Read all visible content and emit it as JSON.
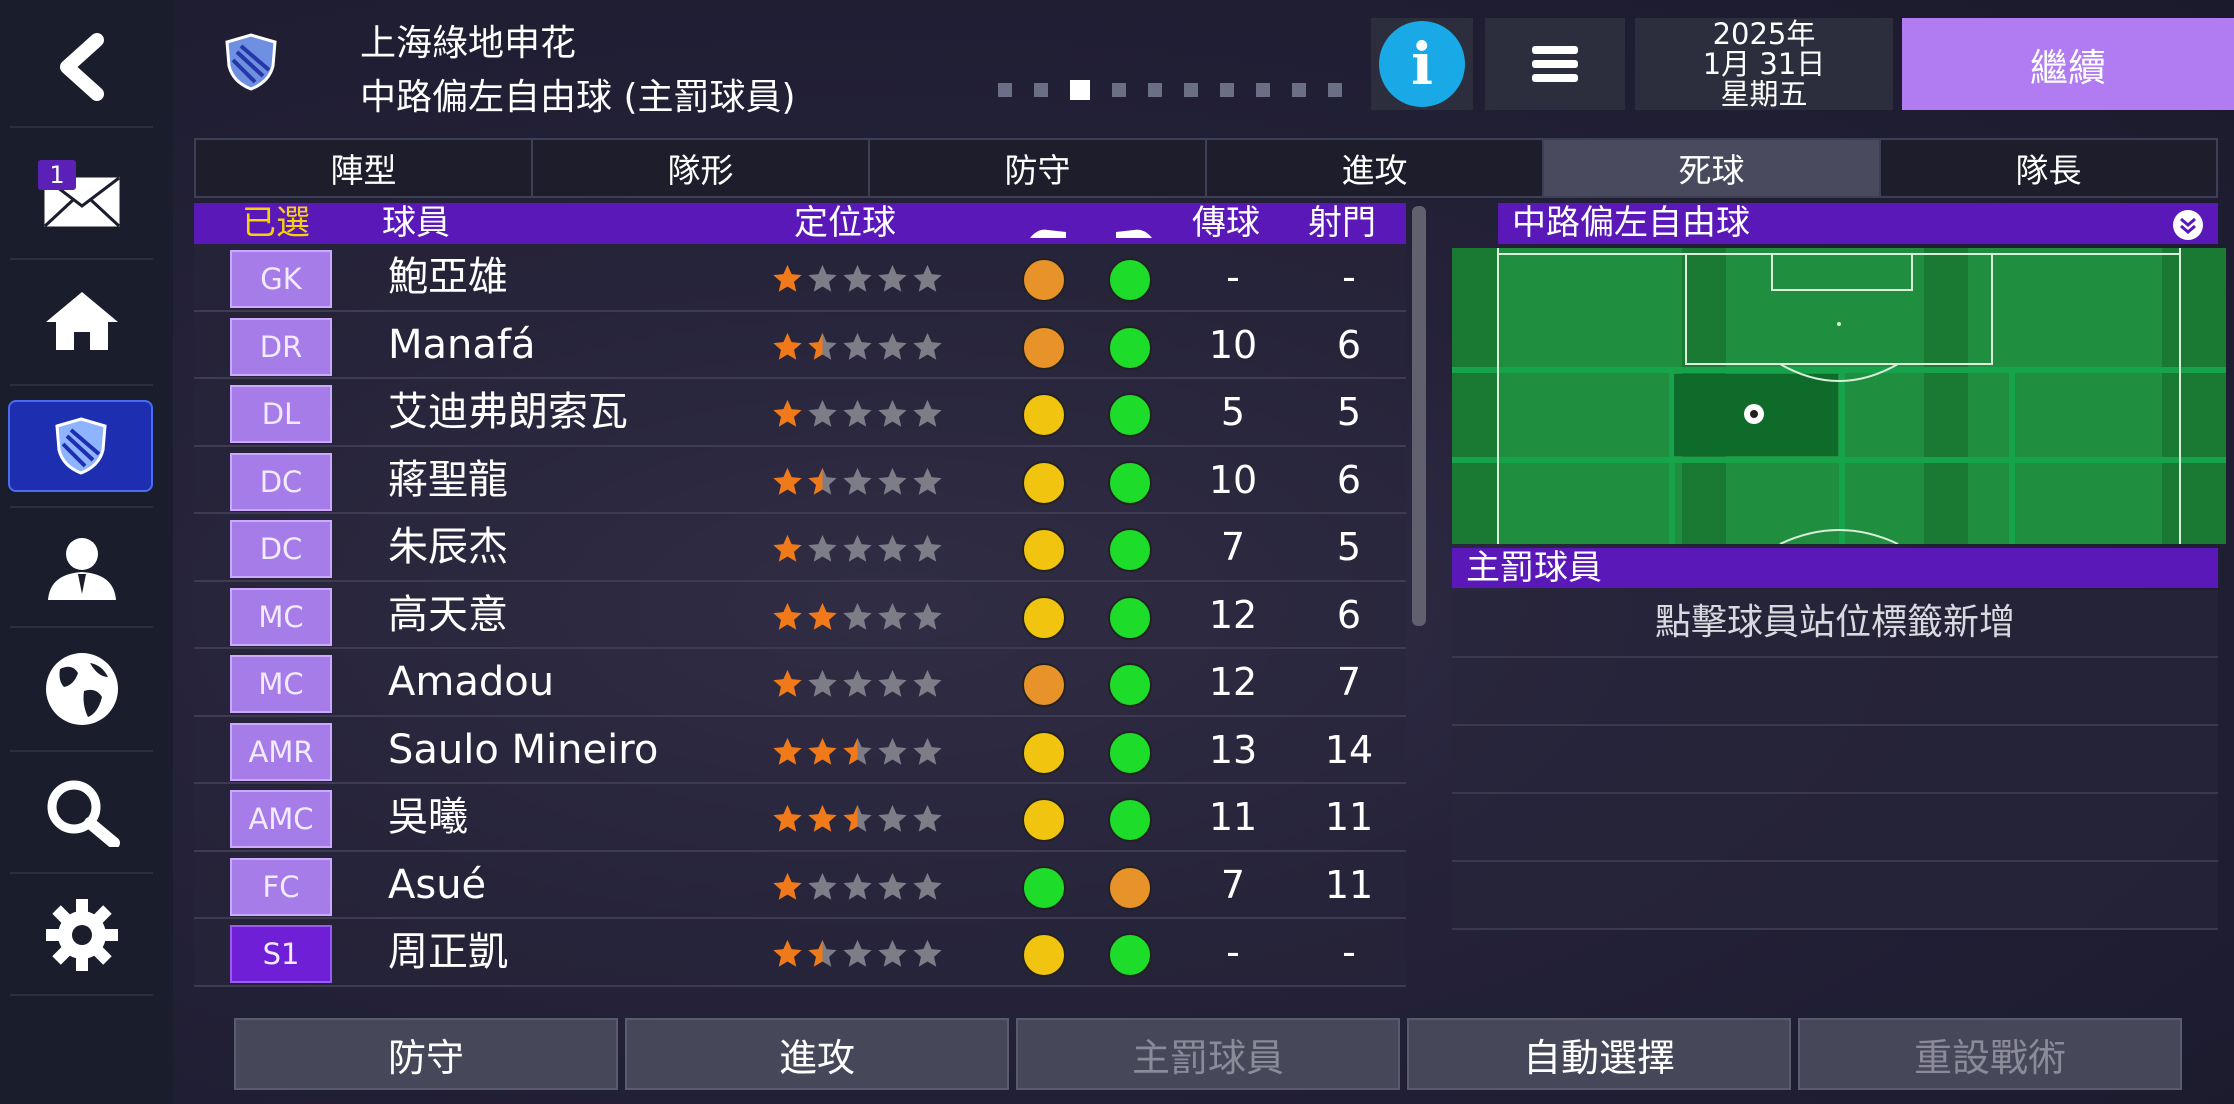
{
  "sidebar": {
    "mail_count": "1",
    "items": [
      {
        "name": "back-icon"
      },
      {
        "name": "inbox-icon"
      },
      {
        "name": "home-icon"
      },
      {
        "name": "club-shield-icon"
      },
      {
        "name": "manager-icon"
      },
      {
        "name": "world-icon"
      },
      {
        "name": "search-icon"
      },
      {
        "name": "settings-icon"
      }
    ]
  },
  "header": {
    "club_name": "上海綠地申花",
    "subtitle": "中路偏左自由球 (主罰球員)",
    "date_year": "2025年",
    "date_day": "1月 31日",
    "date_weekday": "星期五",
    "continue_label": "繼續",
    "page_dots": 10,
    "active_dot": 2
  },
  "tabs": [
    {
      "label": "陣型"
    },
    {
      "label": "隊形"
    },
    {
      "label": "防守"
    },
    {
      "label": "進攻"
    },
    {
      "label": "死球",
      "active": true
    },
    {
      "label": "隊長"
    }
  ],
  "table": {
    "headers": {
      "selected": "已選",
      "player": "球員",
      "set_piece": "定位球",
      "passing": "傳球",
      "shooting": "射門"
    },
    "rows": [
      {
        "pos": "GK",
        "name": "鮑亞雄",
        "stars": 1,
        "left_foot": "orange",
        "right_foot": "green",
        "pass": "-",
        "shot": "-"
      },
      {
        "pos": "DR",
        "name": "Manafá",
        "stars": 1.5,
        "left_foot": "orange",
        "right_foot": "green",
        "pass": "10",
        "shot": "6"
      },
      {
        "pos": "DL",
        "name": "艾迪弗朗索瓦",
        "stars": 1,
        "left_foot": "yellow",
        "right_foot": "green",
        "pass": "5",
        "shot": "5"
      },
      {
        "pos": "DC",
        "name": "蔣聖龍",
        "stars": 1.5,
        "left_foot": "yellow",
        "right_foot": "green",
        "pass": "10",
        "shot": "6"
      },
      {
        "pos": "DC",
        "name": "朱辰杰",
        "stars": 1,
        "left_foot": "yellow",
        "right_foot": "green",
        "pass": "7",
        "shot": "5"
      },
      {
        "pos": "MC",
        "name": "高天意",
        "stars": 2,
        "left_foot": "yellow",
        "right_foot": "green",
        "pass": "12",
        "shot": "6"
      },
      {
        "pos": "MC",
        "name": "Amadou",
        "stars": 1,
        "left_foot": "orange",
        "right_foot": "green",
        "pass": "12",
        "shot": "7"
      },
      {
        "pos": "AMR",
        "name": "Saulo Mineiro",
        "stars": 2.5,
        "left_foot": "yellow",
        "right_foot": "green",
        "pass": "13",
        "shot": "14"
      },
      {
        "pos": "AMC",
        "name": "吳曦",
        "stars": 2.5,
        "left_foot": "yellow",
        "right_foot": "green",
        "pass": "11",
        "shot": "11"
      },
      {
        "pos": "FC",
        "name": "Asué",
        "stars": 1,
        "left_foot": "green",
        "right_foot": "orange",
        "pass": "7",
        "shot": "11"
      },
      {
        "pos": "S1",
        "name": "周正凱",
        "stars": 1.5,
        "left_foot": "yellow",
        "right_foot": "green",
        "pass": "-",
        "shot": "-"
      }
    ]
  },
  "right_panel": {
    "set_piece_title": "中路偏左自由球",
    "taker_title": "主罰球員",
    "hint": "點擊球員站位標籤新增"
  },
  "bottom_buttons": [
    {
      "label": "防守",
      "enabled": true
    },
    {
      "label": "進攻",
      "enabled": true
    },
    {
      "label": "主罰球員",
      "enabled": false
    },
    {
      "label": "自動選擇",
      "enabled": true
    },
    {
      "label": "重設戰術",
      "enabled": false
    }
  ],
  "colors": {
    "accent_purple": "#5a18b8",
    "continue_purple": "#b17cf2",
    "position_tag": "#a67ce8",
    "sub_tag": "#6f1fd6",
    "info_blue": "#18a9e6",
    "star_orange": "#f07a1a",
    "pitch_green": "#1e8a3c"
  }
}
